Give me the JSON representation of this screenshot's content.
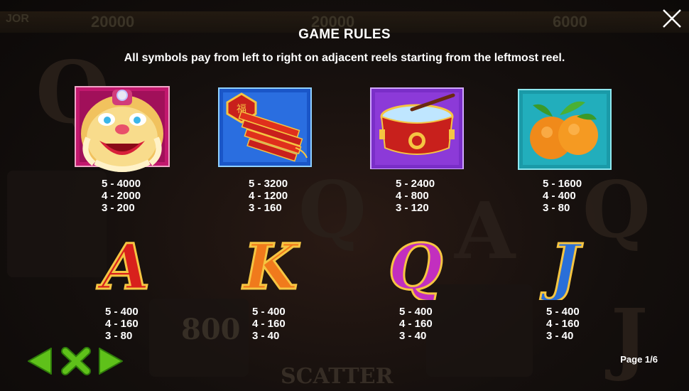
{
  "header": {
    "title": "GAME RULES",
    "subtitle": "All symbols pay from left to right on adjacent reels starting from the leftmost reel."
  },
  "background": {
    "numbers": [
      "20000",
      "20000",
      "6000"
    ],
    "label": "SCATTER",
    "label_small": "JOR",
    "counter": "800"
  },
  "symbols": [
    {
      "name": "Lion dance",
      "pays": [
        "5 - 4000",
        "4 - 2000",
        "3 - 200"
      ]
    },
    {
      "name": "Firecrackers",
      "pays": [
        "5 - 3200",
        "4 - 1200",
        "3 - 160"
      ]
    },
    {
      "name": "Drum",
      "pays": [
        "5 - 2400",
        "4 - 800",
        "3 - 120"
      ]
    },
    {
      "name": "Oranges",
      "pays": [
        "5 - 1600",
        "4 - 400",
        "3 - 80"
      ]
    },
    {
      "name": "A",
      "pays": [
        "5 - 400",
        "4 - 160",
        "3 - 80"
      ]
    },
    {
      "name": "K",
      "pays": [
        "5 - 400",
        "4 - 160",
        "3 - 40"
      ]
    },
    {
      "name": "Q",
      "pays": [
        "5 - 400",
        "4 - 160",
        "3 - 40"
      ]
    },
    {
      "name": "J",
      "pays": [
        "5 - 400",
        "4 - 160",
        "3 - 40"
      ]
    }
  ],
  "footer": {
    "page_indicator": "Page 1/6"
  },
  "icons": {
    "close": "close-icon",
    "prev": "arrow-left-icon",
    "exit": "x-icon",
    "next": "arrow-right-icon"
  },
  "colors": {
    "nav_green": "#5fc11a",
    "letter_a": "#d8201c",
    "letter_k": "#f07a1c",
    "letter_q": "#c22fbf",
    "letter_j": "#2a6fd8",
    "gold_trim": "#f5c542"
  }
}
